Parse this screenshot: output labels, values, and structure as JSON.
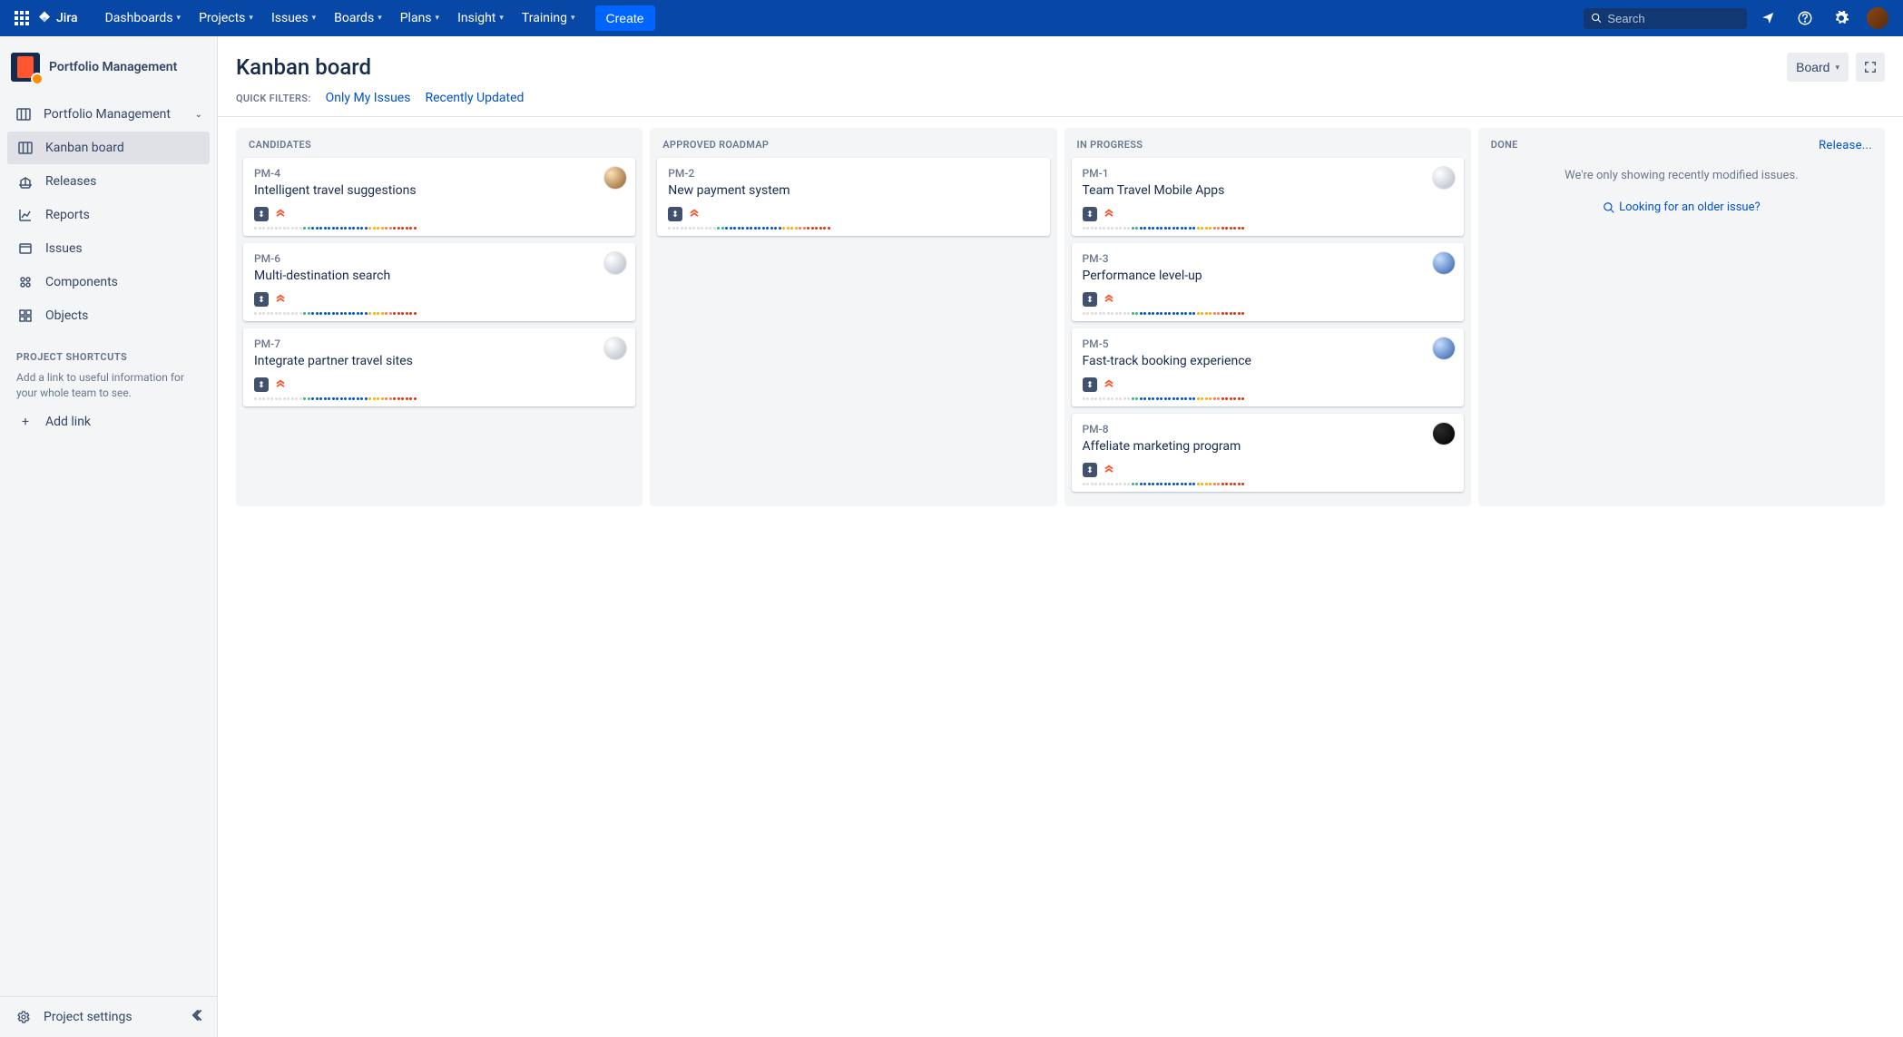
{
  "topnav": {
    "logo_text": "Jira",
    "items": [
      "Dashboards",
      "Projects",
      "Issues",
      "Boards",
      "Plans",
      "Insight",
      "Training"
    ],
    "create_label": "Create",
    "search_placeholder": "Search"
  },
  "sidebar": {
    "project_name": "Portfolio Management",
    "breadcrumb": "Portfolio Management",
    "nav": [
      {
        "label": "Kanban board",
        "icon": "board",
        "active": true
      },
      {
        "label": "Releases",
        "icon": "ship"
      },
      {
        "label": "Reports",
        "icon": "chart"
      },
      {
        "label": "Issues",
        "icon": "issues"
      },
      {
        "label": "Components",
        "icon": "component"
      },
      {
        "label": "Objects",
        "icon": "objects"
      }
    ],
    "shortcuts_heading": "PROJECT SHORTCUTS",
    "shortcuts_desc": "Add a link to useful information for your whole team to see.",
    "add_link_label": "Add link",
    "footer_label": "Project settings"
  },
  "page": {
    "title": "Kanban board",
    "board_button": "Board",
    "quick_filters_label": "QUICK FILTERS:",
    "filters": [
      "Only My Issues",
      "Recently Updated"
    ]
  },
  "board": {
    "release_label": "Release...",
    "columns": [
      {
        "name": "CANDIDATES",
        "cards": [
          {
            "key": "PM-4",
            "title": "Intelligent travel suggestions",
            "avatar": "av-0"
          },
          {
            "key": "PM-6",
            "title": "Multi-destination search",
            "avatar": "av-1"
          },
          {
            "key": "PM-7",
            "title": "Integrate partner travel sites",
            "avatar": "av-1"
          }
        ]
      },
      {
        "name": "APPROVED ROADMAP",
        "cards": [
          {
            "key": "PM-2",
            "title": "New payment system",
            "avatar": ""
          }
        ]
      },
      {
        "name": "IN PROGRESS",
        "cards": [
          {
            "key": "PM-1",
            "title": "Team Travel Mobile Apps",
            "avatar": "av-1"
          },
          {
            "key": "PM-3",
            "title": "Performance level-up",
            "avatar": "av-2"
          },
          {
            "key": "PM-5",
            "title": "Fast-track booking experience",
            "avatar": "av-2"
          },
          {
            "key": "PM-8",
            "title": "Affeliate marketing program",
            "avatar": "av-4"
          }
        ]
      },
      {
        "name": "DONE",
        "cards": [],
        "empty_text": "We're only showing recently modified issues.",
        "empty_link": "Looking for an older issue?"
      }
    ]
  }
}
